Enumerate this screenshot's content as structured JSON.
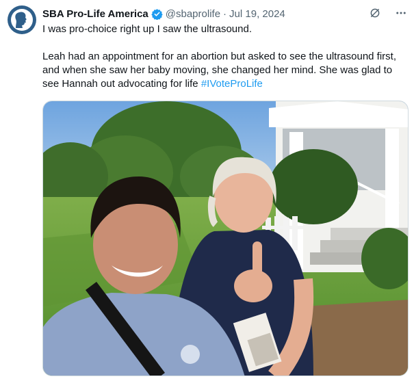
{
  "tweet": {
    "author_name": "SBA Pro-Life America",
    "handle": "@sbaprolife",
    "separator": "·",
    "date": "Jul 19, 2024",
    "line1": "I was pro-choice right up I saw the ultrasound.",
    "line2": "Leah had an appointment for an abortion but asked to see the ultrasound first, and when she saw her baby moving, she changed her mind. She was glad to see Hannah out advocating for life ",
    "hashtag": "#IVoteProLife"
  },
  "icons": {
    "avatar": "silhouette-logo",
    "verified": "verified-badge-icon",
    "grok": "grok-icon",
    "more": "more-icon"
  },
  "colors": {
    "text": "#0f1419",
    "secondary": "#536471",
    "link": "#1d9bf0",
    "verified": "#1d9bf0",
    "avatar_bg": "#2f5f8a"
  }
}
